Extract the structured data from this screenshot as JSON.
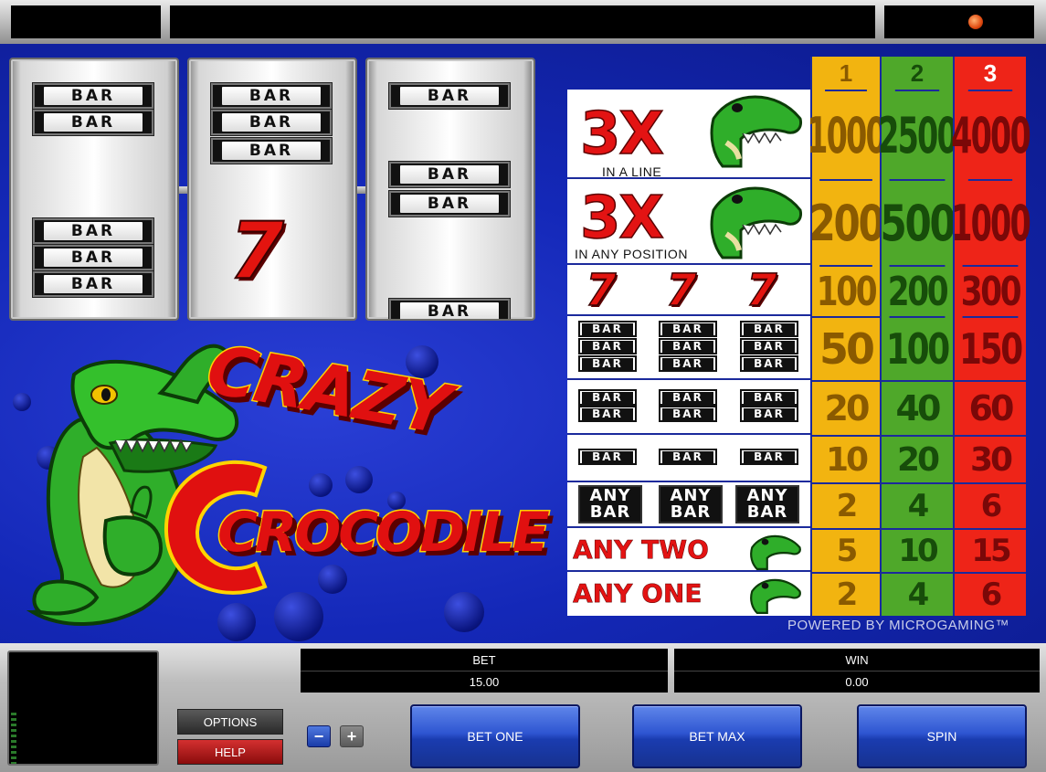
{
  "game": {
    "logo_word1": "CRAZY",
    "logo_word2": "CROCODILE",
    "powered_by": "POWERED BY MICROGAMING™"
  },
  "reels": [
    {
      "symbols": [
        "BAR",
        "BAR",
        "BAR",
        "BAR",
        "BAR"
      ]
    },
    {
      "symbols": [
        "BAR",
        "BAR",
        "BAR",
        "7"
      ]
    },
    {
      "symbols": [
        "BAR",
        "BAR",
        "BAR",
        "BAR"
      ]
    }
  ],
  "paytable": {
    "columns": [
      "1",
      "2",
      "3"
    ],
    "column_colors": [
      "#f2b410",
      "#4fa82a",
      "#ee2418"
    ],
    "rows": [
      {
        "symbol": "3X",
        "caption": "IN A LINE",
        "payouts": [
          "1000",
          "2500",
          "4000"
        ]
      },
      {
        "symbol": "3X",
        "caption": "IN ANY POSITION",
        "payouts": [
          "200",
          "500",
          "1000"
        ]
      },
      {
        "symbol": "7",
        "payouts": [
          "100",
          "200",
          "300"
        ]
      },
      {
        "symbol": "BAR",
        "payouts": [
          "50",
          "100",
          "150"
        ]
      },
      {
        "symbol": "BAR",
        "payouts": [
          "20",
          "40",
          "60"
        ]
      },
      {
        "symbol": "BAR",
        "payouts": [
          "10",
          "20",
          "30"
        ]
      },
      {
        "symbol": "ANY BAR",
        "payouts": [
          "2",
          "4",
          "6"
        ]
      },
      {
        "symbol": "ANY TWO",
        "payouts": [
          "5",
          "10",
          "15"
        ]
      },
      {
        "symbol": "ANY ONE",
        "payouts": [
          "2",
          "4",
          "6"
        ]
      }
    ],
    "any_bar_word1": "ANY",
    "any_bar_word2": "BAR",
    "bar_label": "BAR"
  },
  "controls": {
    "bet_label": "BET",
    "bet_value": "15.00",
    "win_label": "WIN",
    "win_value": "0.00",
    "options_label": "OPTIONS",
    "help_label": "HELP",
    "minus_label": "−",
    "plus_label": "+",
    "bet_one_label": "BET ONE",
    "bet_max_label": "BET MAX",
    "spin_label": "SPIN"
  }
}
